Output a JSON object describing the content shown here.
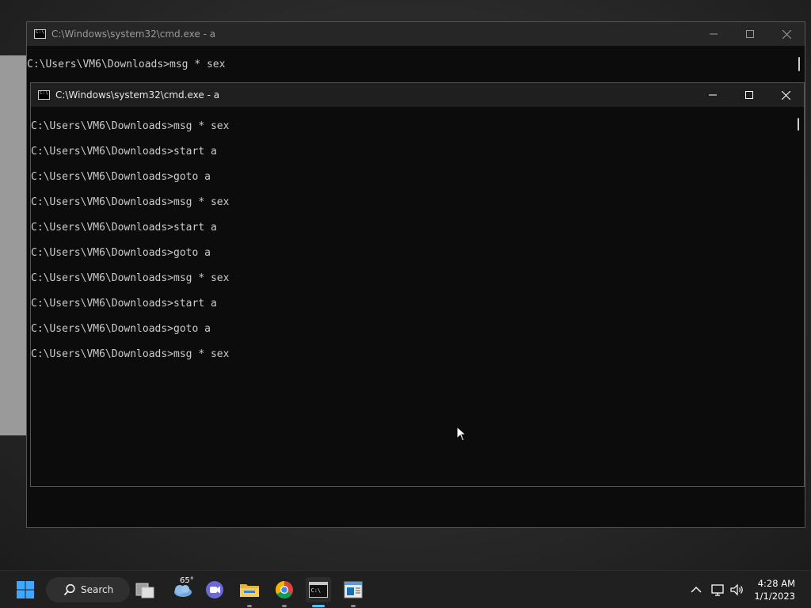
{
  "back_window": {
    "title": "C:\\Windows\\system32\\cmd.exe - a",
    "lines": [
      "C:\\Users\\VM6\\Downloads>msg * sex"
    ]
  },
  "front_window": {
    "title": "C:\\Windows\\system32\\cmd.exe - a",
    "lines": [
      "C:\\Users\\VM6\\Downloads>msg * sex",
      "C:\\Users\\VM6\\Downloads>start a",
      "C:\\Users\\VM6\\Downloads>goto a",
      "C:\\Users\\VM6\\Downloads>msg * sex",
      "C:\\Users\\VM6\\Downloads>start a",
      "C:\\Users\\VM6\\Downloads>goto a",
      "C:\\Users\\VM6\\Downloads>msg * sex",
      "C:\\Users\\VM6\\Downloads>start a",
      "C:\\Users\\VM6\\Downloads>goto a",
      "C:\\Users\\VM6\\Downloads>msg * sex"
    ]
  },
  "taskbar": {
    "search_label": "Search",
    "weather_temp": "65°",
    "time": "4:28 AM",
    "date": "1/1/2023",
    "icons": [
      "start-icon",
      "search-icon",
      "task-view-icon",
      "weather-icon",
      "teams-chat-icon",
      "file-explorer-icon",
      "chrome-icon",
      "terminal-icon",
      "notepad-icon"
    ]
  },
  "colors": {
    "console_bg": "#0c0c0c",
    "console_text": "#cccccc",
    "taskbar_bg": "#202020",
    "accent": "#4cc2ff"
  }
}
